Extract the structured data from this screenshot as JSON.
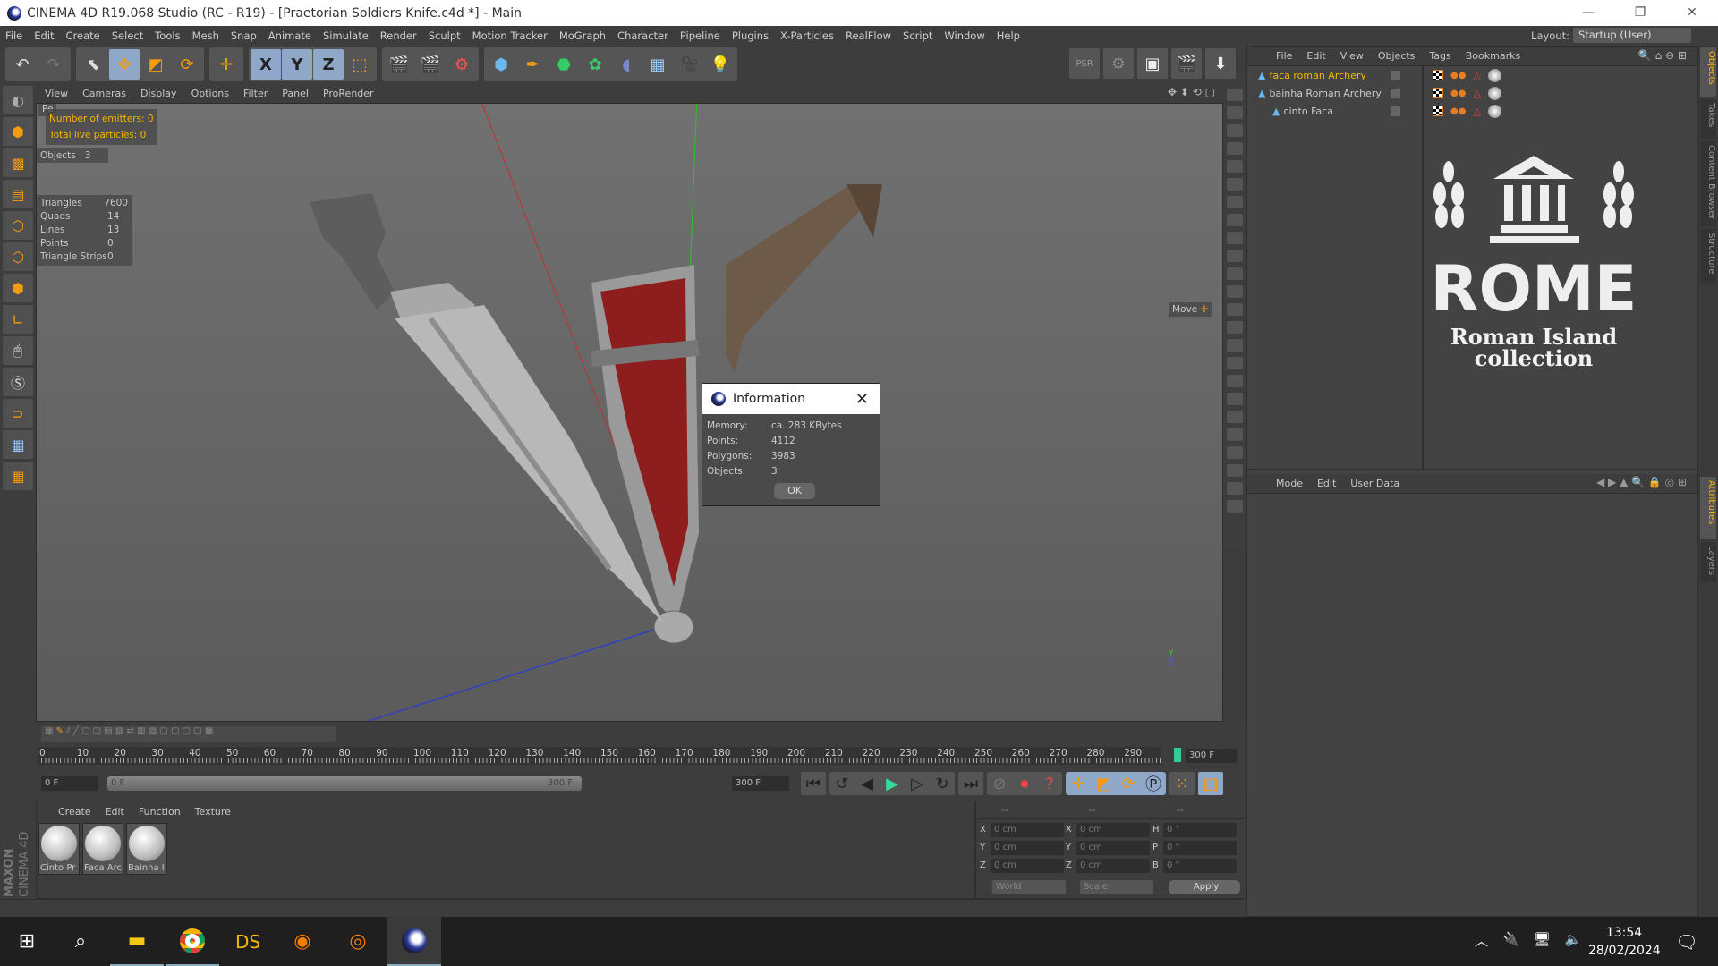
{
  "window": {
    "title": "CINEMA 4D R19.068 Studio (RC - R19) - [Praetorian Soldiers Knife.c4d *] - Main",
    "controls": [
      "—",
      "❐",
      "✕"
    ]
  },
  "menubar": {
    "items": [
      "File",
      "Edit",
      "Create",
      "Select",
      "Tools",
      "Mesh",
      "Snap",
      "Animate",
      "Simulate",
      "Render",
      "Sculpt",
      "Motion Tracker",
      "MoGraph",
      "Character",
      "Pipeline",
      "Plugins",
      "X-Particles",
      "RealFlow",
      "Script",
      "Window",
      "Help"
    ],
    "layout_label": "Layout:",
    "layout_value": "Startup (User)"
  },
  "toolbar": {
    "icons": [
      "undo-icon",
      "redo-icon",
      "select-icon",
      "move-icon",
      "scale-icon",
      "rotate-icon",
      "last-tool-icon",
      "x-axis-icon",
      "y-axis-icon",
      "z-axis-icon",
      "coordinate-system-icon",
      "render-view-icon",
      "render-picture-viewer-icon",
      "render-settings-icon",
      "cube-icon",
      "pen-icon",
      "subdivision-icon",
      "cloner-icon",
      "deformer-icon",
      "floor-icon",
      "camera-icon",
      "light-icon"
    ],
    "axis_labels": [
      "X",
      "Y",
      "Z"
    ]
  },
  "viewport": {
    "menu": [
      "View",
      "Cameras",
      "Display",
      "Options",
      "Filter",
      "Panel",
      "ProRender"
    ],
    "hud_emitters": "Number of emitters: 0",
    "hud_particles": "Total live particles: 0",
    "objects_label": "Objects",
    "objects_value": "3",
    "stats": [
      {
        "k": "Triangles",
        "v": "7600"
      },
      {
        "k": "Quads",
        "v": "14"
      },
      {
        "k": "Lines",
        "v": "13"
      },
      {
        "k": "Points",
        "v": "0"
      },
      {
        "k": "Triangle Strips",
        "v": "0"
      }
    ],
    "move_label": "Move"
  },
  "dialog": {
    "title": "Information",
    "rows": [
      {
        "k": "Memory:",
        "v": "ca. 283 KBytes"
      },
      {
        "k": "Points:",
        "v": "4112"
      },
      {
        "k": "Polygons:",
        "v": "3983"
      },
      {
        "k": "Objects:",
        "v": "3"
      }
    ],
    "ok": "OK"
  },
  "object_manager": {
    "menu": [
      "File",
      "Edit",
      "View",
      "Objects",
      "Tags",
      "Bookmarks"
    ],
    "objects": [
      {
        "name": "faca roman Archery",
        "selected": true
      },
      {
        "name": "bainha Roman Archery",
        "selected": false
      },
      {
        "name": "cinto Faca",
        "selected": false
      }
    ],
    "logo": {
      "word": "ROME",
      "line1": "Roman Island",
      "line2": "collection"
    }
  },
  "attributes": {
    "menu": [
      "Mode",
      "Edit",
      "User Data"
    ]
  },
  "right_tabs": {
    "top": [
      "Objects",
      "Takes",
      "Content Browser",
      "Structure"
    ],
    "bottom": [
      "Attributes",
      "Layers"
    ]
  },
  "timeline": {
    "ticks": [
      "0",
      "10",
      "20",
      "30",
      "40",
      "50",
      "60",
      "70",
      "80",
      "90",
      "100",
      "110",
      "120",
      "130",
      "140",
      "150",
      "160",
      "170",
      "180",
      "190",
      "200",
      "210",
      "220",
      "230",
      "240",
      "250",
      "260",
      "270",
      "280",
      "290"
    ],
    "end_field": "300 F",
    "current": "0 F",
    "range_start": "0 F",
    "range_end": "300 F",
    "max": "300 F"
  },
  "materials": {
    "menu": [
      "Create",
      "Edit",
      "Function",
      "Texture"
    ],
    "items": [
      "Cinto Pr",
      "Faca Arc",
      "Bainha I"
    ]
  },
  "coordinates": {
    "headers": [
      "--",
      "--",
      "--"
    ],
    "rows": [
      {
        "a": "X",
        "av": "0 cm",
        "b": "X",
        "bv": "0 cm",
        "c": "H",
        "cv": "0 °"
      },
      {
        "a": "Y",
        "av": "0 cm",
        "b": "Y",
        "bv": "0 cm",
        "c": "P",
        "cv": "0 °"
      },
      {
        "a": "Z",
        "av": "0 cm",
        "b": "Z",
        "bv": "0 cm",
        "c": "B",
        "cv": "0 °"
      }
    ],
    "world": "World",
    "scale": "Scale",
    "apply": "Apply"
  },
  "brand": {
    "line1": "MAXON",
    "line2": "CINEMA 4D"
  },
  "taskbar": {
    "time": "13:54",
    "date": "28/02/2024",
    "apps": [
      "start-icon",
      "search-icon",
      "file-explorer-icon",
      "chrome-icon",
      "daz-studio-icon",
      "blender-icon",
      "houdini-icon",
      "cinema4d-icon"
    ],
    "ds": "DS"
  }
}
